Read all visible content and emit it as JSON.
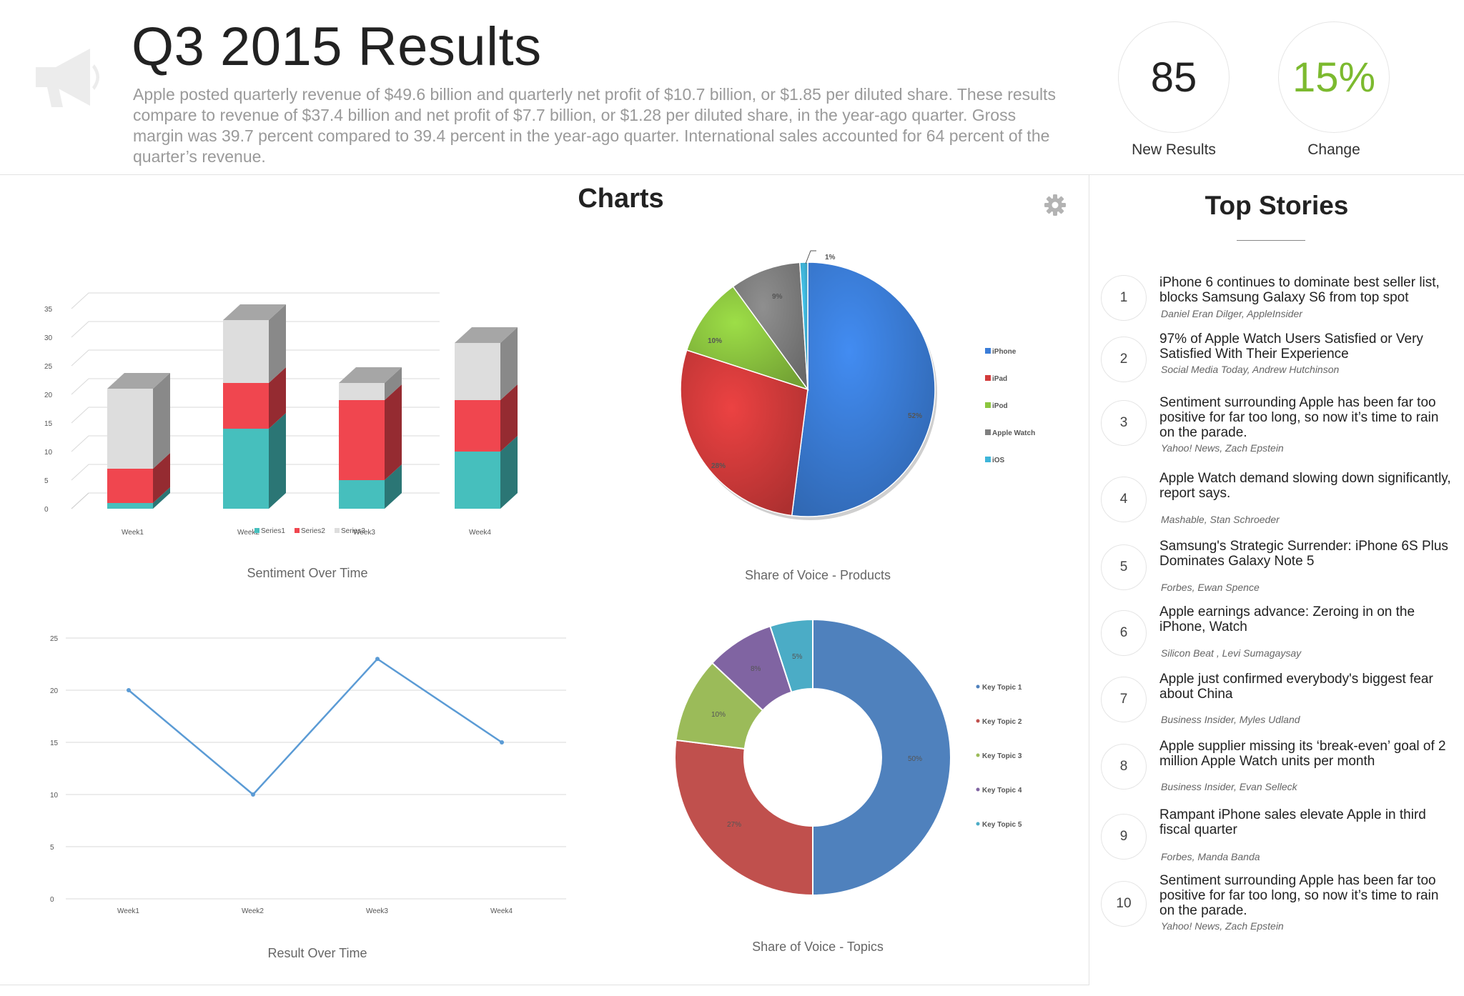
{
  "header": {
    "title": "Q3 2015 Results",
    "description": "Apple posted quarterly revenue of $49.6 billion and quarterly net profit of $10.7 billion, or $1.85 per diluted share. These results compare to revenue of $37.4 billion and net profit of $7.7 billion, or $1.28 per diluted share, in the year-ago quarter. Gross margin was 39.7 percent compared to 39.4 percent in the year-ago quarter. International sales accounted for 64 percent of the quarter’s revenue.",
    "logo_icon": "megaphone-icon",
    "stats": [
      {
        "value": "85",
        "label": "New Results",
        "color": "#222222"
      },
      {
        "value": "15%",
        "label": "Change",
        "color": "#7cba2f"
      }
    ]
  },
  "charts_section": {
    "title": "Charts",
    "settings_icon": "gear-icon"
  },
  "chart_data": [
    {
      "type": "bar",
      "stacked": true,
      "three_d": true,
      "caption": "Sentiment Over Time",
      "categories": [
        "Week1",
        "Week2",
        "Week3",
        "Week4"
      ],
      "series": [
        {
          "name": "Series1",
          "values": [
            1,
            14,
            5,
            10
          ],
          "color": "#46bfbd"
        },
        {
          "name": "Series2",
          "values": [
            6,
            8,
            14,
            9
          ],
          "color": "#f0464f"
        },
        {
          "name": "Series3",
          "values": [
            14,
            11,
            3,
            10
          ],
          "color": "#dddddd"
        }
      ],
      "yticks": [
        0,
        5,
        10,
        15,
        20,
        25,
        30,
        35
      ],
      "ylim": [
        0,
        35
      ],
      "grid": true,
      "legend": "bottom"
    },
    {
      "type": "pie",
      "three_d": true,
      "caption": "Share of Voice - Products",
      "slices": [
        {
          "label": "iPhone",
          "value": 52,
          "text": "52%",
          "color": "#3b7dd8"
        },
        {
          "label": "iPad",
          "value": 28,
          "text": "28%",
          "color": "#d33b3b"
        },
        {
          "label": "iPod",
          "value": 10,
          "text": "10%",
          "color": "#8cc63f"
        },
        {
          "label": "Apple Watch",
          "value": 9,
          "text": "9%",
          "color": "#808080"
        },
        {
          "label": "iOS",
          "value": 1,
          "text": "1%",
          "color": "#3fb5d9"
        }
      ],
      "legend": "right"
    },
    {
      "type": "line",
      "caption": "Result Over Time",
      "x": [
        "Week1",
        "Week2",
        "Week3",
        "Week4"
      ],
      "series": [
        {
          "values": [
            20,
            10,
            23,
            15
          ],
          "color": "#5b9bd5"
        }
      ],
      "yticks": [
        0,
        5,
        10,
        15,
        20,
        25
      ],
      "ylim": [
        0,
        25
      ],
      "grid": true
    },
    {
      "type": "pie",
      "donut": true,
      "caption": "Share of Voice - Topics",
      "slices": [
        {
          "label": "Key Topic 1",
          "value": 50,
          "text": "50%",
          "color": "#4f81bd"
        },
        {
          "label": "Key Topic 2",
          "value": 27,
          "text": "27%",
          "color": "#c0504d"
        },
        {
          "label": "Key Topic 3",
          "value": 10,
          "text": "10%",
          "color": "#9bbb59"
        },
        {
          "label": "Key Topic 4",
          "value": 8,
          "text": "8%",
          "color": "#8064a2"
        },
        {
          "label": "Key Topic 5",
          "value": 5,
          "text": "5%",
          "color": "#4bacc6"
        }
      ],
      "legend": "right"
    }
  ],
  "top_stories": {
    "title": "Top Stories",
    "items": [
      {
        "num": "1",
        "title": "iPhone 6 continues to dominate best seller list, blocks Samsung Galaxy S6 from top spot",
        "source": "Daniel Eran Dilger, AppleInsider"
      },
      {
        "num": "2",
        "title": "97% of Apple Watch Users Satisfied or Very Satisfied With Their Experience",
        "source": "Social Media Today, Andrew Hutchinson"
      },
      {
        "num": "3",
        "title": "Sentiment surrounding Apple has been far too positive for far too long, so now it’s time to rain on the parade.",
        "source": "Yahoo! News, Zach Epstein"
      },
      {
        "num": "4",
        "title": "Apple Watch demand slowing down significantly, report says.",
        "source": "Mashable, Stan Schroeder"
      },
      {
        "num": "5",
        "title": "Samsung's Strategic Surrender: iPhone 6S Plus Dominates Galaxy Note 5",
        "source": "Forbes, Ewan Spence"
      },
      {
        "num": "6",
        "title": "Apple earnings advance: Zeroing in on the iPhone, Watch",
        "source": "Silicon Beat , Levi Sumagaysay"
      },
      {
        "num": "7",
        "title": "Apple just confirmed everybody's biggest fear about China",
        "source": "Business Insider, Myles Udland"
      },
      {
        "num": "8",
        "title": "Apple supplier missing its ‘break-even’ goal of 2 million Apple Watch units per month",
        "source": "Business Insider, Evan Selleck"
      },
      {
        "num": "9",
        "title": "Rampant iPhone sales elevate Apple in third fiscal quarter",
        "source": "Forbes, Manda Banda"
      },
      {
        "num": "10",
        "title": "Sentiment surrounding Apple has been far too positive for far too long, so now it’s time to rain on the parade.",
        "source": "Yahoo! News, Zach Epstein"
      }
    ]
  }
}
